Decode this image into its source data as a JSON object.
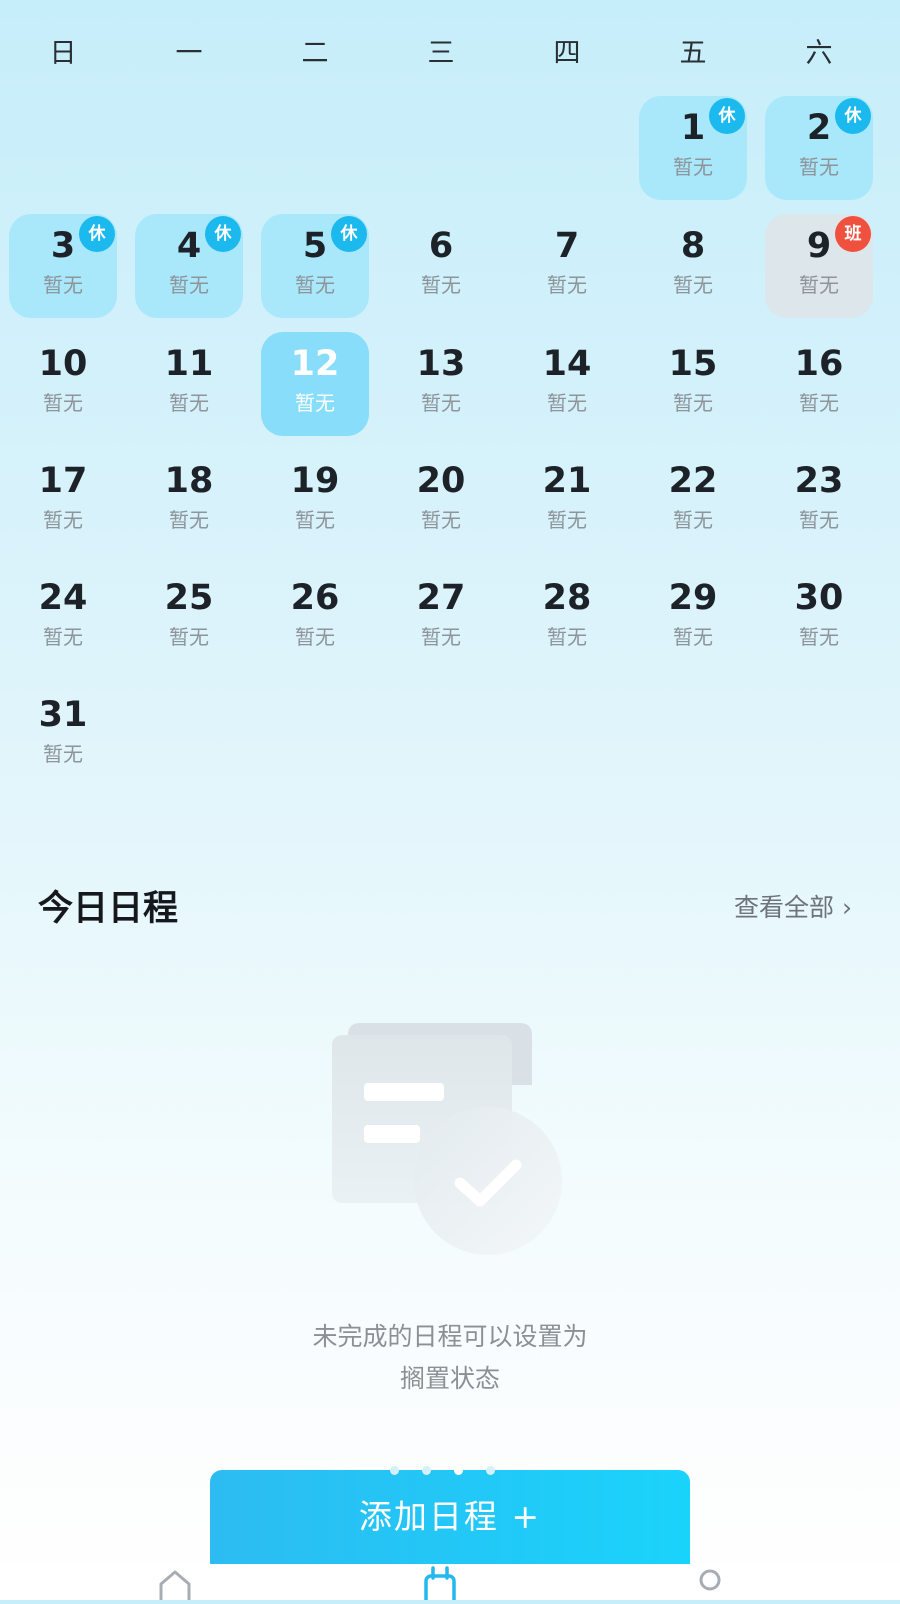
{
  "weekdays": [
    "日",
    "一",
    "二",
    "三",
    "四",
    "五",
    "六"
  ],
  "days": [
    {
      "num": "1",
      "sub": "暂无",
      "badge": "休"
    },
    {
      "num": "2",
      "sub": "暂无",
      "badge": "休"
    },
    {
      "num": "3",
      "sub": "暂无",
      "badge": "休"
    },
    {
      "num": "4",
      "sub": "暂无",
      "badge": "休"
    },
    {
      "num": "5",
      "sub": "暂无",
      "badge": "休"
    },
    {
      "num": "6",
      "sub": "暂无"
    },
    {
      "num": "7",
      "sub": "暂无"
    },
    {
      "num": "8",
      "sub": "暂无"
    },
    {
      "num": "9",
      "sub": "暂无",
      "badge": "班"
    },
    {
      "num": "10",
      "sub": "暂无"
    },
    {
      "num": "11",
      "sub": "暂无"
    },
    {
      "num": "12",
      "sub": "暂无",
      "selected": true
    },
    {
      "num": "13",
      "sub": "暂无"
    },
    {
      "num": "14",
      "sub": "暂无"
    },
    {
      "num": "15",
      "sub": "暂无"
    },
    {
      "num": "16",
      "sub": "暂无"
    },
    {
      "num": "17",
      "sub": "暂无"
    },
    {
      "num": "18",
      "sub": "暂无"
    },
    {
      "num": "19",
      "sub": "暂无"
    },
    {
      "num": "20",
      "sub": "暂无"
    },
    {
      "num": "21",
      "sub": "暂无"
    },
    {
      "num": "22",
      "sub": "暂无"
    },
    {
      "num": "23",
      "sub": "暂无"
    },
    {
      "num": "24",
      "sub": "暂无"
    },
    {
      "num": "25",
      "sub": "暂无"
    },
    {
      "num": "26",
      "sub": "暂无"
    },
    {
      "num": "27",
      "sub": "暂无"
    },
    {
      "num": "28",
      "sub": "暂无"
    },
    {
      "num": "29",
      "sub": "暂无"
    },
    {
      "num": "30",
      "sub": "暂无"
    },
    {
      "num": "31",
      "sub": "暂无"
    }
  ],
  "today_schedule": {
    "title": "今日日程",
    "view_all": "查看全部 ›"
  },
  "empty_state": {
    "line1": "未完成的日程可以设置为",
    "line2": "搁置状态",
    "illustration_icon": "document-check-icon"
  },
  "carousel": {
    "count": 4,
    "active": 2
  },
  "add_button": {
    "label": "添加日程 +"
  },
  "tab_bar": {
    "icons": [
      "home-icon",
      "calendar-icon",
      "profile-icon"
    ]
  },
  "colors": {
    "holiday_bg": "#a9e7fb",
    "workday_bg": "#dde6ea",
    "selected_bg": "#87ddfa",
    "holiday_badge": "#1cb9ef",
    "workday_badge": "#f0513e",
    "button_start": "#2dbcf2",
    "button_end": "#1ad3fb"
  }
}
